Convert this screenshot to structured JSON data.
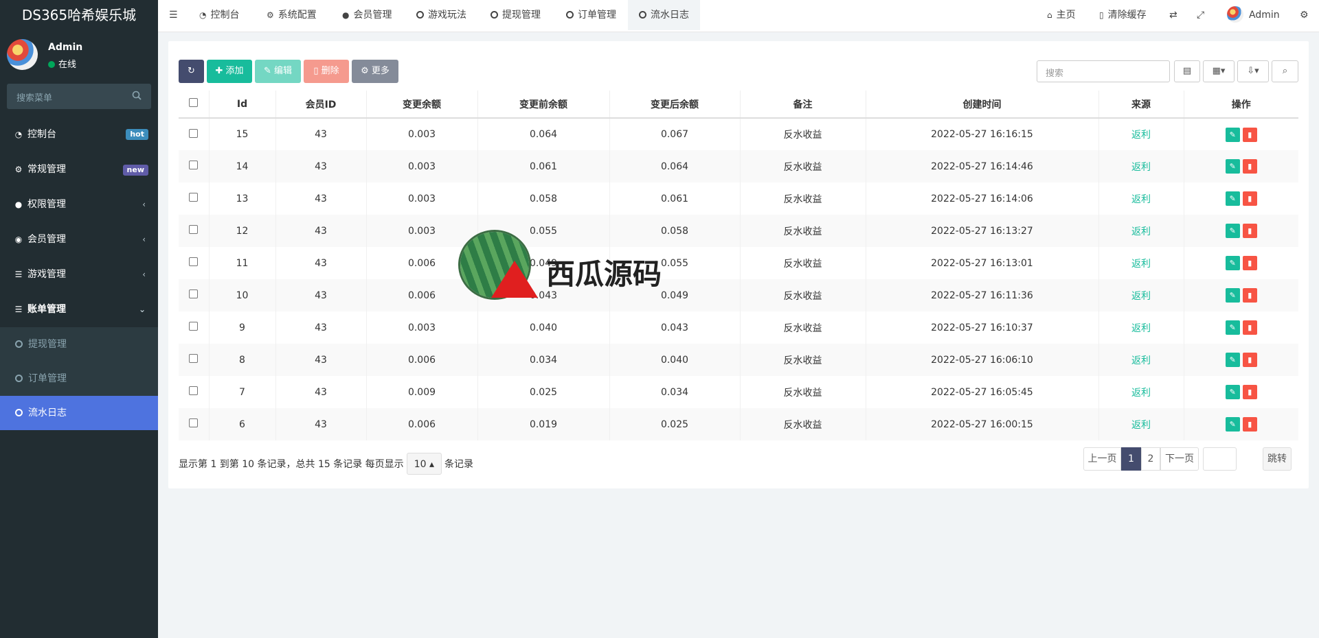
{
  "app": {
    "title": "DS365哈希娱乐城"
  },
  "user": {
    "name": "Admin",
    "status": "在线"
  },
  "sidebar": {
    "search_placeholder": "搜索菜单",
    "items": [
      {
        "label": "控制台",
        "badge": "hot",
        "badge_color": "#3c8dbc"
      },
      {
        "label": "常规管理",
        "badge": "new",
        "badge_color": "#605ca8"
      },
      {
        "label": "权限管理"
      },
      {
        "label": "会员管理"
      },
      {
        "label": "游戏管理"
      },
      {
        "label": "账单管理"
      }
    ],
    "sub_items": [
      {
        "label": "提现管理"
      },
      {
        "label": "订单管理"
      },
      {
        "label": "流水日志"
      }
    ]
  },
  "topbar": {
    "tabs": [
      "控制台",
      "系统配置",
      "会员管理",
      "游戏玩法",
      "提现管理",
      "订单管理",
      "流水日志"
    ],
    "home": "主页",
    "clear_cache": "清除缓存",
    "admin": "Admin"
  },
  "toolbar": {
    "add": "添加",
    "edit": "编辑",
    "delete": "删除",
    "more": "更多",
    "search_placeholder": "搜索"
  },
  "table": {
    "headers": [
      "Id",
      "会员ID",
      "变更余额",
      "变更前余额",
      "变更后余额",
      "备注",
      "创建时间",
      "来源",
      "操作"
    ],
    "rows": [
      [
        "15",
        "43",
        "0.003",
        "0.064",
        "0.067",
        "反水收益",
        "2022-05-27 16:16:15",
        "返利"
      ],
      [
        "14",
        "43",
        "0.003",
        "0.061",
        "0.064",
        "反水收益",
        "2022-05-27 16:14:46",
        "返利"
      ],
      [
        "13",
        "43",
        "0.003",
        "0.058",
        "0.061",
        "反水收益",
        "2022-05-27 16:14:06",
        "返利"
      ],
      [
        "12",
        "43",
        "0.003",
        "0.055",
        "0.058",
        "反水收益",
        "2022-05-27 16:13:27",
        "返利"
      ],
      [
        "11",
        "43",
        "0.006",
        "0.049",
        "0.055",
        "反水收益",
        "2022-05-27 16:13:01",
        "返利"
      ],
      [
        "10",
        "43",
        "0.006",
        "0.043",
        "0.049",
        "反水收益",
        "2022-05-27 16:11:36",
        "返利"
      ],
      [
        "9",
        "43",
        "0.003",
        "0.040",
        "0.043",
        "反水收益",
        "2022-05-27 16:10:37",
        "返利"
      ],
      [
        "8",
        "43",
        "0.006",
        "0.034",
        "0.040",
        "反水收益",
        "2022-05-27 16:06:10",
        "返利"
      ],
      [
        "7",
        "43",
        "0.009",
        "0.025",
        "0.034",
        "反水收益",
        "2022-05-27 16:05:45",
        "返利"
      ],
      [
        "6",
        "43",
        "0.006",
        "0.019",
        "0.025",
        "反水收益",
        "2022-05-27 16:00:15",
        "返利"
      ]
    ]
  },
  "pagination": {
    "info_prefix": "显示第 1 到第 10 条记录，总共 15 条记录 每页显示",
    "page_size": "10",
    "info_suffix": "条记录",
    "prev": "上一页",
    "pages": [
      "1",
      "2"
    ],
    "next": "下一页",
    "jump": "跳转"
  },
  "watermark": {
    "text": "西瓜源码"
  }
}
